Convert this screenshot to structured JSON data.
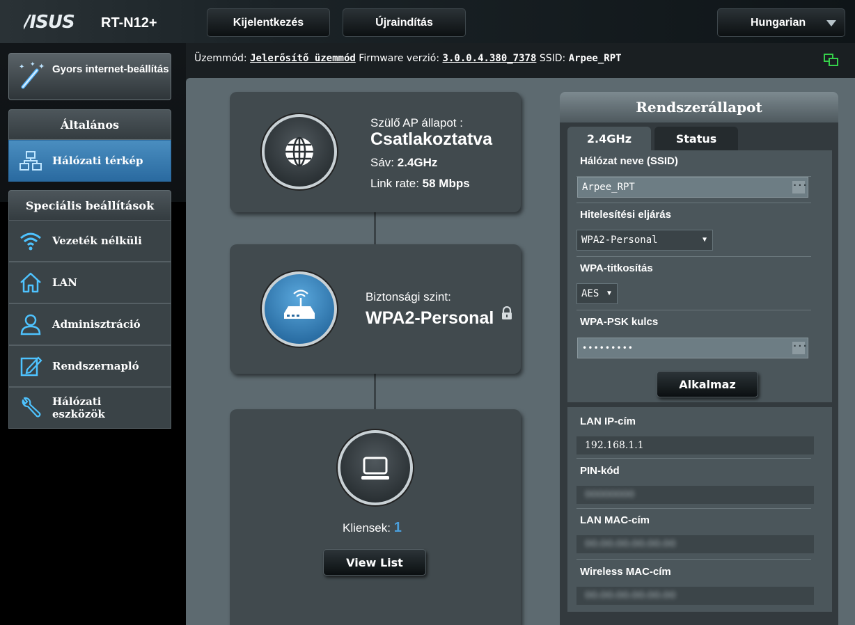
{
  "header": {
    "logo": "/ISUS",
    "model": "RT-N12+",
    "logout_label": "Kijelentkezés",
    "reboot_label": "Újraindítás",
    "language": "Hungarian"
  },
  "sidebar": {
    "quick_setup": "Gyors internet-beállítás",
    "general_title": "Általános",
    "network_map": "Hálózati térkép",
    "advanced_title": "Speciális beállítások",
    "items": [
      {
        "label": "Vezeték nélküli",
        "icon": "wifi-icon"
      },
      {
        "label": "LAN",
        "icon": "home-icon"
      },
      {
        "label": "Adminisztráció",
        "icon": "user-icon"
      },
      {
        "label": "Rendszernapló",
        "icon": "log-icon"
      },
      {
        "label": "Hálózati eszközök",
        "icon": "tools-icon"
      }
    ]
  },
  "status": {
    "mode_label": "Üzemmód:",
    "mode_value": "Jelerősítő üzemmód",
    "firmware_label": "Firmware verzió:",
    "firmware_value": "3.0.0.4.380_7378",
    "ssid_label": "SSID:",
    "ssid_value": "Arpee_RPT"
  },
  "map": {
    "parent_ap_label": "Szülő AP állapot :",
    "parent_ap_status": "Csatlakoztatva",
    "band_label": "Sáv:",
    "band_value": "2.4GHz",
    "link_rate_label": "Link rate:",
    "link_rate_value": "58 Mbps",
    "security_label": "Biztonsági szint:",
    "security_value": "WPA2-Personal",
    "clients_label": "Kliensek:",
    "clients_count": "1",
    "view_list": "View List"
  },
  "system_status": {
    "title": "Rendszerállapot",
    "tab_band": "2.4GHz",
    "tab_status": "Status",
    "ssid_label": "Hálózat neve (SSID)",
    "ssid_value": "Arpee_RPT",
    "auth_label": "Hitelesítési eljárás",
    "auth_value": "WPA2-Personal",
    "encryption_label": "WPA-titkosítás",
    "encryption_value": "AES",
    "psk_label": "WPA-PSK kulcs",
    "psk_value": "•••••••••",
    "apply_label": "Alkalmaz",
    "lan_ip_label": "LAN IP-cím",
    "lan_ip_value": "192.168.1.1",
    "pin_label": "PIN-kód",
    "pin_value": "00000000",
    "lan_mac_label": "LAN MAC-cím",
    "lan_mac_value": "00:00:00:00:00:00",
    "wireless_mac_label": "Wireless MAC-cím",
    "wireless_mac_value": "00:00:00:00:00:00"
  },
  "colors": {
    "accent": "#4a8ec0",
    "client_count": "#4a9fdc",
    "panel": "#414a4e",
    "status_icon": "#35d04a"
  }
}
